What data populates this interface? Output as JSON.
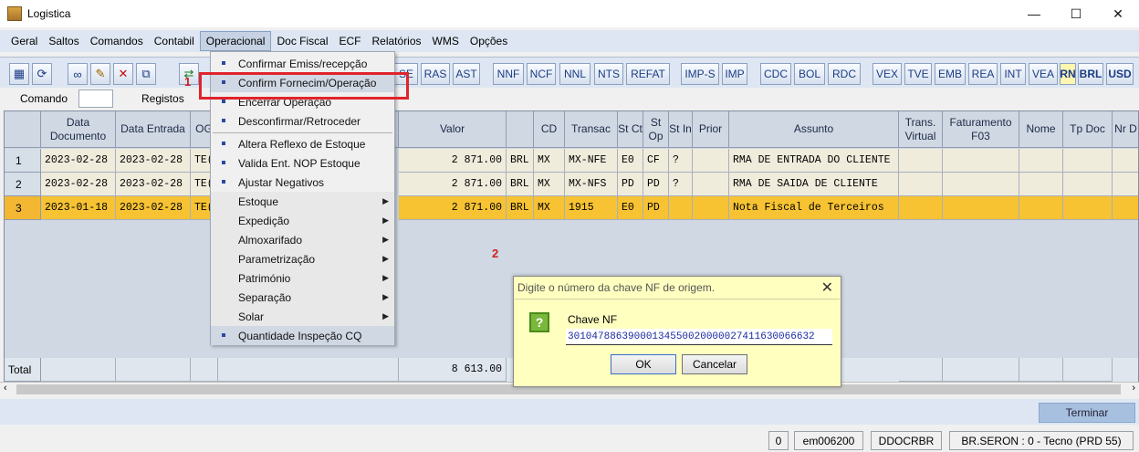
{
  "window": {
    "title": "Logistica",
    "minimize": "—",
    "maximize": "☐",
    "close": "✕"
  },
  "menu": [
    "Geral",
    "Saltos",
    "Comandos",
    "Contabil",
    "Operacional",
    "Doc Fiscal",
    "ECF",
    "Relatórios",
    "WMS",
    "Opções"
  ],
  "toolbar": {
    "buttons1": [
      "RAS",
      "AST"
    ],
    "buttons2": [
      "NNF",
      "NCF",
      "NNL",
      "NTS",
      "REFAT"
    ],
    "buttons3": [
      "IMP-S",
      "IMP"
    ],
    "buttons4": [
      "CDC",
      "BOL",
      "RDC"
    ],
    "buttons5": [
      "VEX",
      "TVE",
      "EMB",
      "REA",
      "INT",
      "VEA"
    ],
    "partial": [
      "SE",
      "RN"
    ],
    "currency": [
      "BRL",
      "USD"
    ]
  },
  "cmdrow": {
    "comando": "Comando",
    "registos": "Registos"
  },
  "grid": {
    "headers": [
      "Data Documento",
      "Data Entrada",
      "OG",
      "Valor",
      "",
      "CD",
      "Transac",
      "St Ct",
      "St Op",
      "St In",
      "Prior",
      "Assunto",
      "Trans. Virtual",
      "Faturamento F03",
      "Nome",
      "Tp Doc",
      "Nr D"
    ],
    "rows": [
      {
        "n": "1",
        "doc": "2023-02-28",
        "ent": "2023-02-28",
        "og": "TE(",
        "valor": "2 871.00",
        "moeda": "BRL",
        "cd": "MX",
        "trans": "MX-NFE",
        "stct": "E0",
        "stop": "CF",
        "stin": "?",
        "assunto": "RMA DE ENTRADA DO CLIENTE"
      },
      {
        "n": "2",
        "doc": "2023-02-28",
        "ent": "2023-02-28",
        "og": "TE(",
        "valor": "2 871.00",
        "moeda": "BRL",
        "cd": "MX",
        "trans": "MX-NFS",
        "stct": "PD",
        "stop": "PD",
        "stin": "?",
        "assunto": "RMA DE SAIDA DE CLIENTE"
      },
      {
        "n": "3",
        "doc": "2023-01-18",
        "ent": "2023-02-28",
        "og": "TE(",
        "valor": "2 871.00",
        "moeda": "BRL",
        "cd": "MX",
        "trans": "1915",
        "stct": "E0",
        "stop": "PD",
        "stin": "",
        "assunto": "Nota Fiscal de Terceiros"
      }
    ],
    "total_label": "Total",
    "total_value": "8 613.00"
  },
  "dropdown": {
    "items": [
      {
        "label": "Confirmar Emiss/recepção",
        "type": "bullet"
      },
      {
        "label": "Confirm Fornecim/Operação",
        "type": "bullet"
      },
      {
        "label": "Encerrar Operação",
        "type": "bullet"
      },
      {
        "label": "Desconfirmar/Retroceder",
        "type": "bullet"
      },
      {
        "label": "Altera Reflexo de Estoque",
        "type": "bullet"
      },
      {
        "label": "Valida Ent. NOP Estoque",
        "type": "bullet"
      },
      {
        "label": "Ajustar Negativos",
        "type": "bullet"
      },
      {
        "label": "Estoque",
        "type": "sub"
      },
      {
        "label": "Expedição",
        "type": "sub"
      },
      {
        "label": "Almoxarifado",
        "type": "sub"
      },
      {
        "label": "Parametrização",
        "type": "sub"
      },
      {
        "label": "Património",
        "type": "sub"
      },
      {
        "label": "Separação",
        "type": "sub"
      },
      {
        "label": "Solar",
        "type": "sub"
      },
      {
        "label": "Quantidade Inspeção CQ",
        "type": "bullet"
      }
    ]
  },
  "annotations": {
    "one": "1",
    "two": "2"
  },
  "dialog": {
    "title": "Digite o número da chave NF de origem.",
    "close": "✕",
    "label": "Chave NF",
    "value": "30104788639000134550020000027411630066632",
    "ok": "OK",
    "cancel": "Cancelar"
  },
  "bottom": {
    "terminar": "Terminar"
  },
  "status": {
    "count": "0",
    "user": "em006200",
    "code": "DDOCRBR",
    "db": "BR.SERON : 0 - Tecno (PRD 55)"
  }
}
